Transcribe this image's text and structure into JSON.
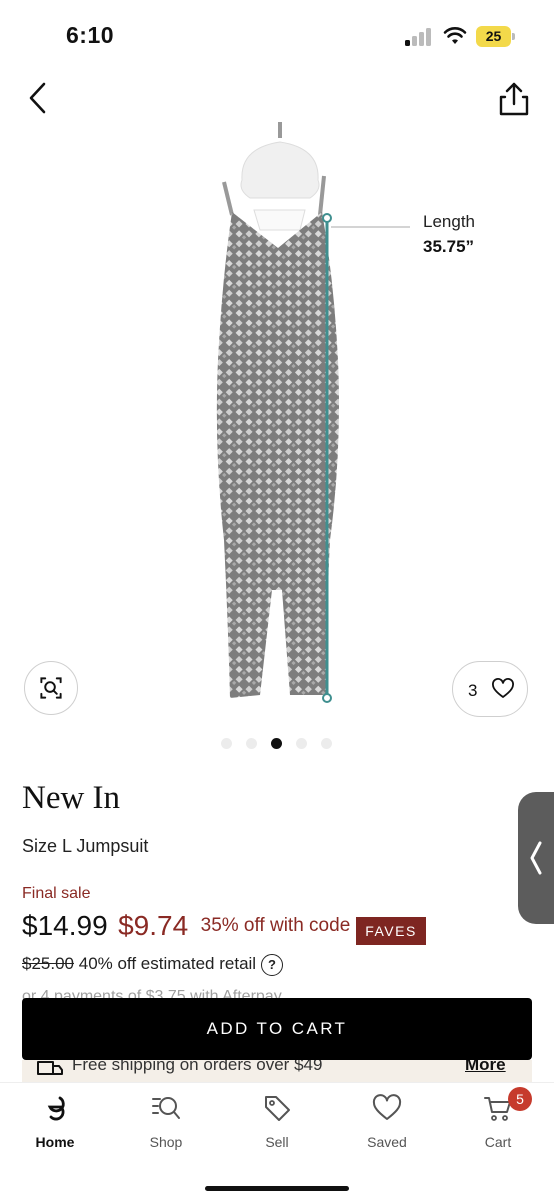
{
  "status_bar": {
    "time": "6:10",
    "battery": "25",
    "battery_color": "#f3d94a"
  },
  "nav": {
    "back_icon": "chevron-left-icon",
    "share_icon": "share-icon"
  },
  "product_image": {
    "measurement_label": "Length",
    "measurement_value": "35.75”",
    "fave_count": "3",
    "carousel": {
      "total": 5,
      "active_index": 2
    }
  },
  "product": {
    "brand": "New In",
    "size_prefix": "Size L",
    "category": "Jumpsuit",
    "final_sale": "Final sale",
    "price_original": "$14.99",
    "price_sale": "$9.74",
    "discount_text": "35% off with code",
    "code": "FAVES",
    "retail_price": "$25.00",
    "retail_text": "40% off estimated retail",
    "help_glyph": "?",
    "afterpay_text": "or 4 payments of $3.75 with Afterpay"
  },
  "actions": {
    "add_to_cart": "ADD TO CART"
  },
  "shipping": {
    "text": "Free shipping on orders over $49",
    "more": "More"
  },
  "tabbar": {
    "items": [
      {
        "label": "Home",
        "icon": "home-logo-icon",
        "active": true
      },
      {
        "label": "Shop",
        "icon": "search-icon",
        "active": false
      },
      {
        "label": "Sell",
        "icon": "tag-icon",
        "active": false
      },
      {
        "label": "Saved",
        "icon": "heart-icon",
        "active": false
      },
      {
        "label": "Cart",
        "icon": "cart-icon",
        "active": false
      }
    ],
    "cart_badge": "5"
  },
  "colors": {
    "sale_red": "#8a2a24",
    "badge_red": "#7e2621",
    "cart_badge_red": "#c63a2c",
    "measure_line": "#3f8f8f"
  }
}
